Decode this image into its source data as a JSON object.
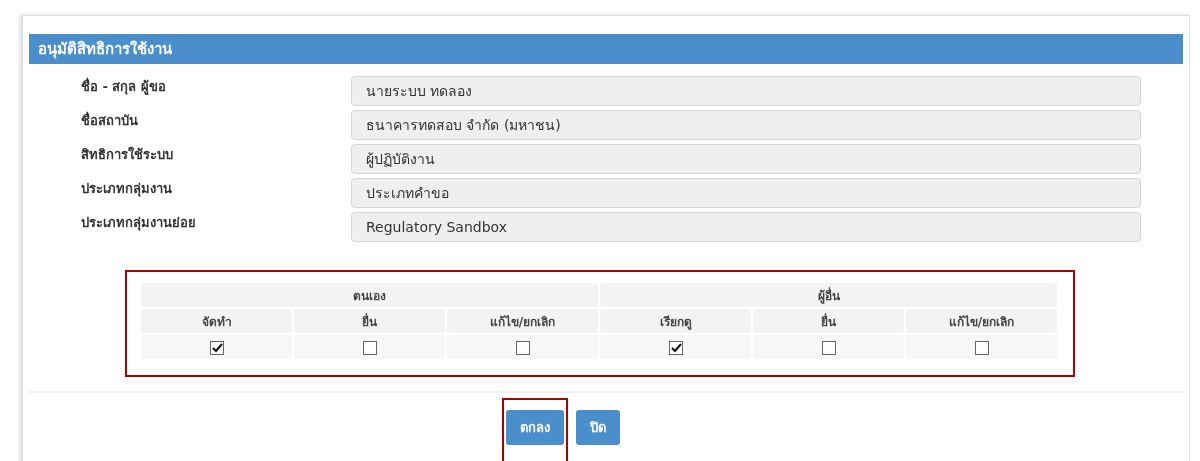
{
  "panel": {
    "title": "อนุมัติสิทธิการใช้งาน"
  },
  "fields": [
    {
      "label": "ชื่อ - สกุล ผู้ขอ",
      "value": "นายระบบ ทดลอง"
    },
    {
      "label": "ชื่อสถาบัน",
      "value": "ธนาคารทดสอบ จำกัด (มหาชน)"
    },
    {
      "label": "สิทธิการใช้ระบบ",
      "value": "ผู้ปฏิบัติงาน"
    },
    {
      "label": "ประเภทกลุ่มงาน",
      "value": "ประเภทคำขอ"
    },
    {
      "label": "ประเภทกลุ่มงานย่อย",
      "value": "Regulatory Sandbox"
    }
  ],
  "permissions": {
    "highlighted": true,
    "groups": [
      {
        "title": "ตนเอง",
        "columns": [
          {
            "label": "จัดทำ",
            "checked": true
          },
          {
            "label": "ยื่น",
            "checked": false
          },
          {
            "label": "แก้ไข/ยกเลิก",
            "checked": false
          }
        ]
      },
      {
        "title": "ผู้อื่น",
        "columns": [
          {
            "label": "เรียกดู",
            "checked": true
          },
          {
            "label": "ยื่น",
            "checked": false
          },
          {
            "label": "แก้ไข/ยกเลิก",
            "checked": false
          }
        ]
      }
    ]
  },
  "buttons": [
    {
      "label": "ตกลง",
      "highlighted": true
    },
    {
      "label": "ปิด",
      "highlighted": false
    }
  ]
}
